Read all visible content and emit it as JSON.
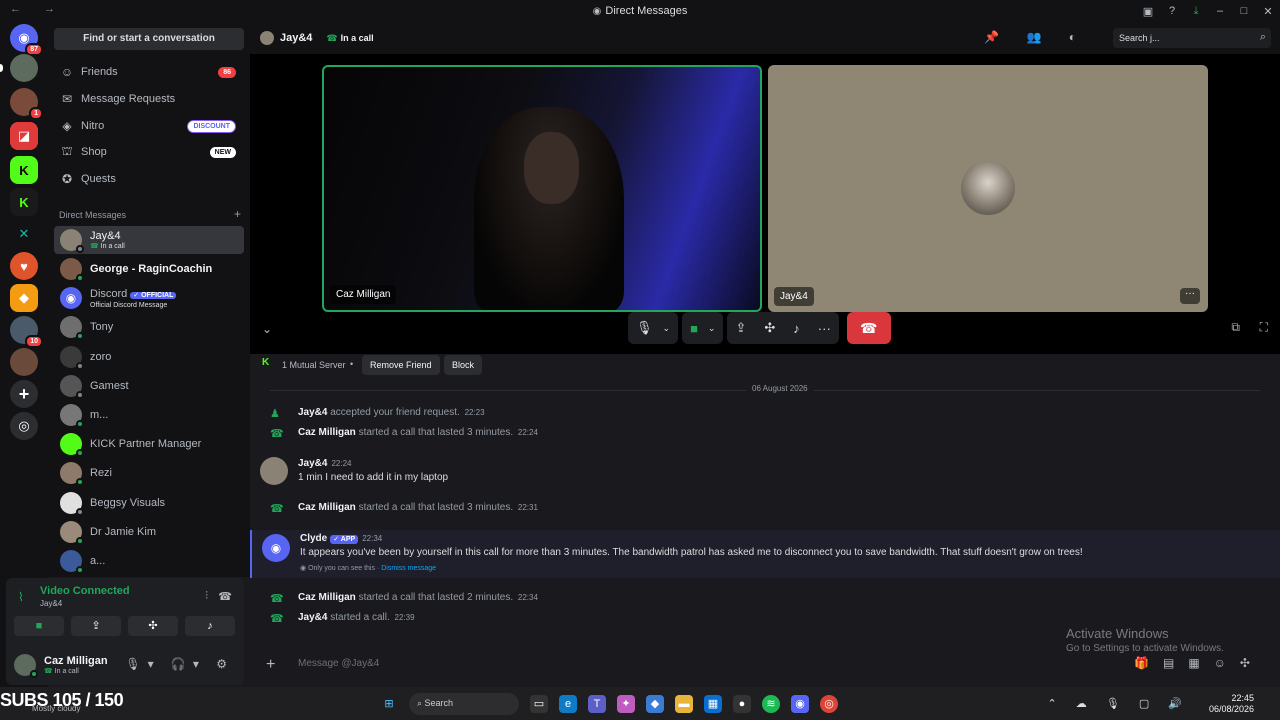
{
  "window": {
    "title": "Direct Messages"
  },
  "sidebar": {
    "search_label": "Find or start a conversation",
    "nav": [
      {
        "label": "Friends",
        "badge": "86"
      },
      {
        "label": "Message Requests"
      },
      {
        "label": "Nitro",
        "tag": "DISCOUNT"
      },
      {
        "label": "Shop",
        "tag": "NEW"
      },
      {
        "label": "Quests"
      }
    ],
    "dm_header": "Direct Messages",
    "dm_add": "+",
    "dms": [
      {
        "name": "Jay&4",
        "sub": "In a call"
      },
      {
        "name": "George - RaginCoachin"
      },
      {
        "name": "Discord",
        "tag": "OFFICIAL",
        "sub": "Official Discord Message"
      },
      {
        "name": "Tony"
      },
      {
        "name": "zoro"
      },
      {
        "name": "Gamest"
      },
      {
        "name": "m..."
      },
      {
        "name": "KICK Partner Manager"
      },
      {
        "name": "Rezi"
      },
      {
        "name": "Beggsy Visuals"
      },
      {
        "name": "Dr Jamie Kim"
      },
      {
        "name": "a..."
      }
    ]
  },
  "rail": {
    "badges": [
      "87",
      "1",
      "10"
    ]
  },
  "voice": {
    "status": "Video Connected",
    "channel": "Jay&4"
  },
  "user": {
    "name": "Caz Milligan",
    "status": "In a call"
  },
  "header": {
    "name": "Jay&4",
    "status": "In a call",
    "search_placeholder": "Search j..."
  },
  "call": {
    "tiles": [
      {
        "label": "Caz Milligan"
      },
      {
        "label": "Jay&4"
      }
    ]
  },
  "profile_bar": {
    "mutual": "1 Mutual Server",
    "remove": "Remove Friend",
    "block": "Block"
  },
  "chat": {
    "date": "06 August 2026",
    "m1": {
      "author": "Jay&4",
      "text": "accepted your friend request.",
      "time": "22:23"
    },
    "m2": {
      "author": "Caz Milligan",
      "text": "started a call that lasted 3 minutes.",
      "time": "22:24"
    },
    "m3": {
      "author": "Jay&4",
      "time": "22:24",
      "text": "1 min I need to add it in my laptop"
    },
    "m4": {
      "author": "Caz Milligan",
      "text": "started a call that lasted 3 minutes.",
      "time": "22:31"
    },
    "m5": {
      "author": "Clyde",
      "tag": "APP",
      "time": "22:34",
      "text": "It appears you've been by yourself in this call for more than 3 minutes. The bandwidth patrol has asked me to disconnect you to save bandwidth. That stuff doesn't grow on trees!",
      "note": "Only you can see this ·",
      "dismiss": "Dismiss message"
    },
    "m6": {
      "author": "Caz Milligan",
      "text": "started a call that lasted 2 minutes.",
      "time": "22:34"
    },
    "m7": {
      "author": "Jay&4",
      "text": "started a call.",
      "time": "22:39"
    }
  },
  "composer": {
    "placeholder": "Message @Jay&4"
  },
  "watermark": {
    "line1": "Activate Windows",
    "line2": "Go to Settings to activate Windows."
  },
  "overlay": {
    "subs": "SUBS 105 / 150",
    "weather": "Mostly cloudy"
  },
  "taskbar": {
    "search": "Search",
    "time": "22:45",
    "date": "06/08/2026"
  }
}
